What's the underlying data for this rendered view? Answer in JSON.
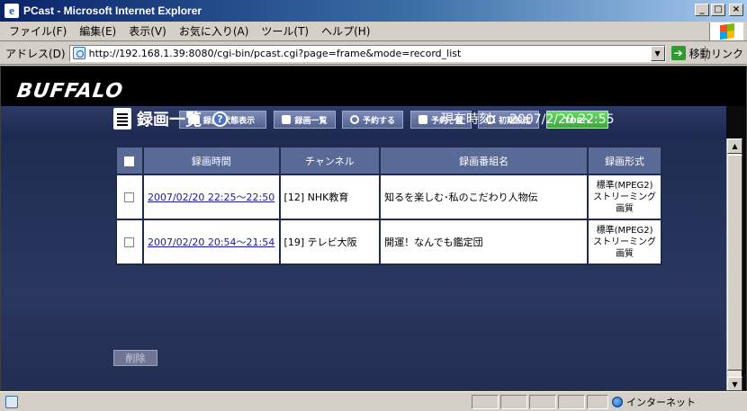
{
  "window": {
    "title": "PCast - Microsoft Internet Explorer",
    "buttons": {
      "minimize": "_",
      "maximize": "□",
      "close": "×"
    }
  },
  "menu": {
    "items": [
      "ファイル(F)",
      "編集(E)",
      "表示(V)",
      "お気に入り(A)",
      "ツール(T)",
      "ヘルプ(H)"
    ]
  },
  "address": {
    "label": "アドレス(D)",
    "url": "http://192.168.1.39:8080/cgi-bin/pcast.cgi?page=frame&mode=record_list",
    "go_label": "移動",
    "links_label": "リンク"
  },
  "page": {
    "logo": "BUFFALO",
    "nav": [
      {
        "label": "録画/状態表示",
        "icon": "monitor-icon"
      },
      {
        "label": "録画一覧",
        "icon": "document-icon"
      },
      {
        "label": "予約する",
        "icon": "clock-icon"
      },
      {
        "label": "予約一覧",
        "icon": "reserve-list-icon"
      },
      {
        "label": "初期設定",
        "icon": "settings-icon"
      },
      {
        "label": "TOPへ",
        "icon": ""
      }
    ],
    "heading": "録画一覧",
    "clock_label": "現在時刻：",
    "clock_value": "2007/2/20 22:55",
    "table": {
      "headers": [
        "録画時間",
        "チャンネル",
        "録画番組名",
        "録画形式"
      ],
      "rows": [
        {
          "time": "2007/02/20 22:25〜22:50",
          "channel": "[12] NHK教育",
          "title": "知るを楽しむ･私のこだわり人物伝",
          "format": [
            "標準(MPEG2)",
            "ストリーミング",
            "画質"
          ]
        },
        {
          "time": "2007/02/20 20:54〜21:54",
          "channel": "[19] テレビ大阪",
          "title": "開運！なんでも鑑定団",
          "format": [
            "標準(MPEG2)",
            "ストリーミング",
            "画質"
          ]
        }
      ]
    },
    "delete_label": "削除"
  },
  "status": {
    "zone_label": "インターネット"
  }
}
